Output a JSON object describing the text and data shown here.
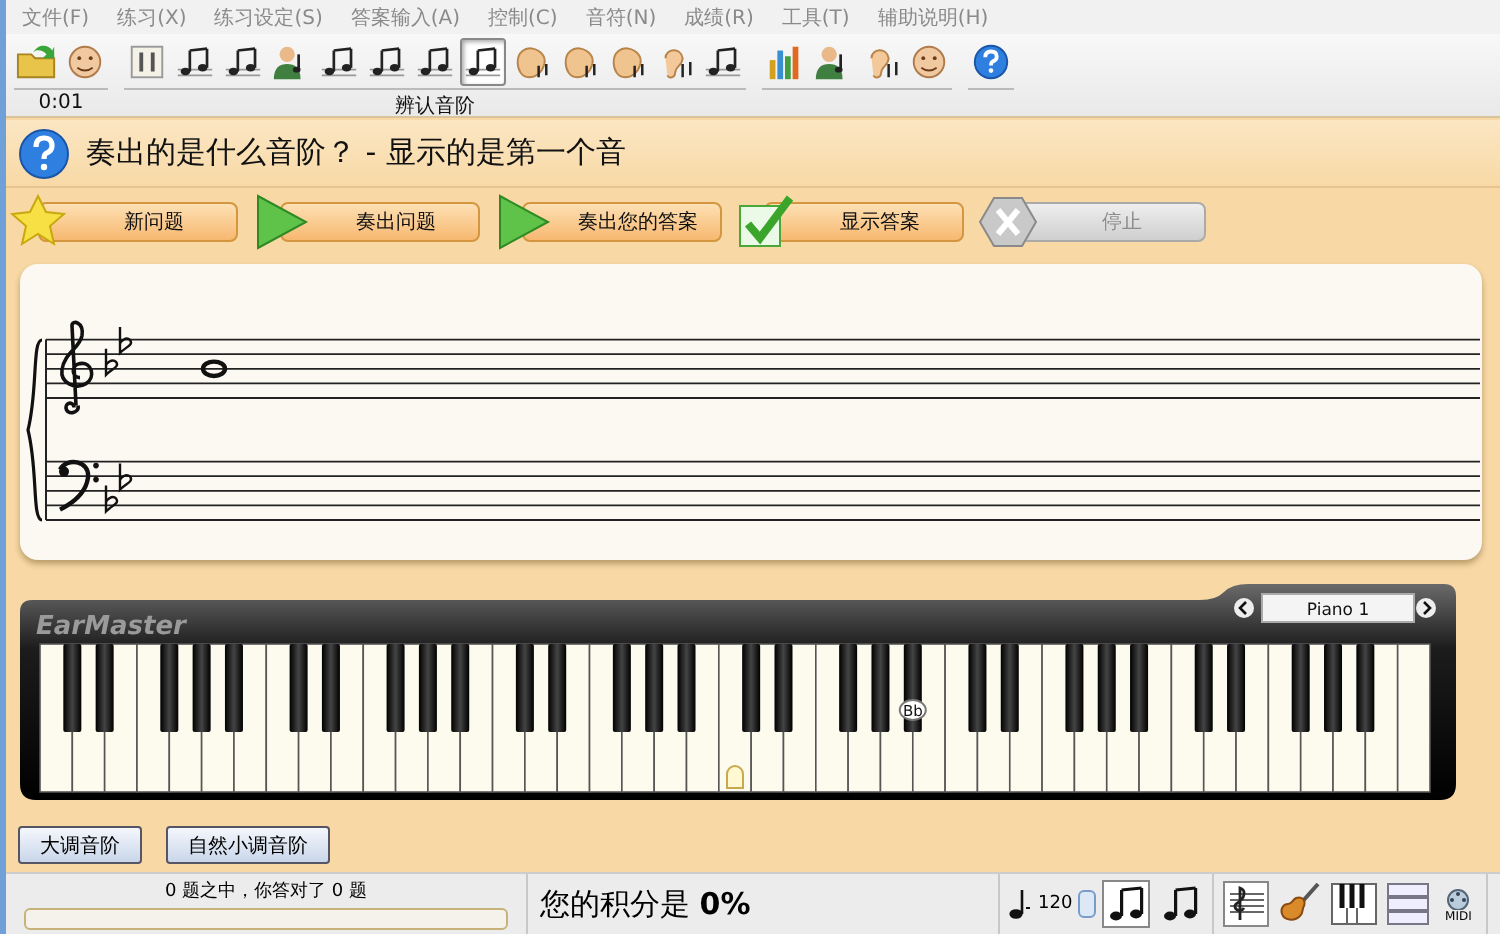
{
  "menu": [
    {
      "label": "文件(F)"
    },
    {
      "label": "练习(X)"
    },
    {
      "label": "练习设定(S)"
    },
    {
      "label": "答案输入(A)"
    },
    {
      "label": "控制(C)"
    },
    {
      "label": "音符(N)"
    },
    {
      "label": "成绩(R)"
    },
    {
      "label": "工具(T)"
    },
    {
      "label": "辅助说明(H)"
    }
  ],
  "toolbar": {
    "groups": [
      {
        "label": "0:01",
        "buttons": [
          {
            "kind": "folder",
            "selected": false
          },
          {
            "kind": "face",
            "selected": false
          }
        ]
      },
      {
        "label": "辨认音阶",
        "buttons": [
          {
            "kind": "panel",
            "selected": false
          },
          {
            "kind": "notes",
            "selected": false
          },
          {
            "kind": "notes",
            "selected": false
          },
          {
            "kind": "person",
            "selected": false
          },
          {
            "kind": "notes",
            "selected": false
          },
          {
            "kind": "notes",
            "selected": false
          },
          {
            "kind": "notes",
            "selected": false
          },
          {
            "kind": "notes",
            "selected": true
          },
          {
            "kind": "hand",
            "selected": false
          },
          {
            "kind": "hand",
            "selected": false
          },
          {
            "kind": "hand",
            "selected": false
          },
          {
            "kind": "ear",
            "selected": false
          },
          {
            "kind": "notes",
            "selected": false
          }
        ]
      },
      {
        "buttons": [
          {
            "kind": "chart",
            "selected": false
          },
          {
            "kind": "person",
            "selected": false
          },
          {
            "kind": "ear",
            "selected": false
          },
          {
            "kind": "face",
            "selected": false
          }
        ]
      },
      {
        "buttons": [
          {
            "kind": "help",
            "selected": false
          }
        ]
      }
    ]
  },
  "question": {
    "title": "奏出的是什么音阶？ - 显示的是第一个音"
  },
  "actions": [
    {
      "label": "新问题",
      "kind": "star",
      "disabled": false
    },
    {
      "label": "奏出问题",
      "kind": "play",
      "disabled": false
    },
    {
      "label": "奏出您的答案",
      "kind": "play",
      "disabled": false
    },
    {
      "label": "显示答案",
      "kind": "check",
      "disabled": false
    },
    {
      "label": "停止",
      "kind": "stop",
      "disabled": true
    }
  ],
  "score": {
    "staves": [
      {
        "kind": "treble",
        "key_signature": [
          {
            "kind": "flat"
          },
          {
            "kind": "flat"
          }
        ],
        "notes": [
          {
            "kind": "whole"
          }
        ]
      },
      {
        "kind": "bass",
        "key_signature": [
          {
            "kind": "flat"
          },
          {
            "kind": "flat"
          }
        ]
      }
    ]
  },
  "piano": {
    "logo": "EarMaster",
    "instrument": "Piano 1",
    "middle_c_marker": true,
    "key_labels": [
      {
        "label": "Bb"
      }
    ]
  },
  "answers": [
    {
      "label": "大调音阶"
    },
    {
      "label": "自然小调音阶"
    }
  ],
  "status": {
    "summary": "0 题之中，你答对了 0 题",
    "progress": {
      "level": 0
    },
    "score": "您的积分是 **0%**",
    "tempo": "120",
    "note_toggles": [
      {
        "selected": true
      },
      {
        "selected": false
      }
    ],
    "tools": [
      {
        "kind": "staff"
      },
      {
        "kind": "guitar"
      },
      {
        "kind": "piano"
      },
      {
        "kind": "list"
      },
      {
        "kind": "midi",
        "label": "MIDI"
      }
    ]
  }
}
